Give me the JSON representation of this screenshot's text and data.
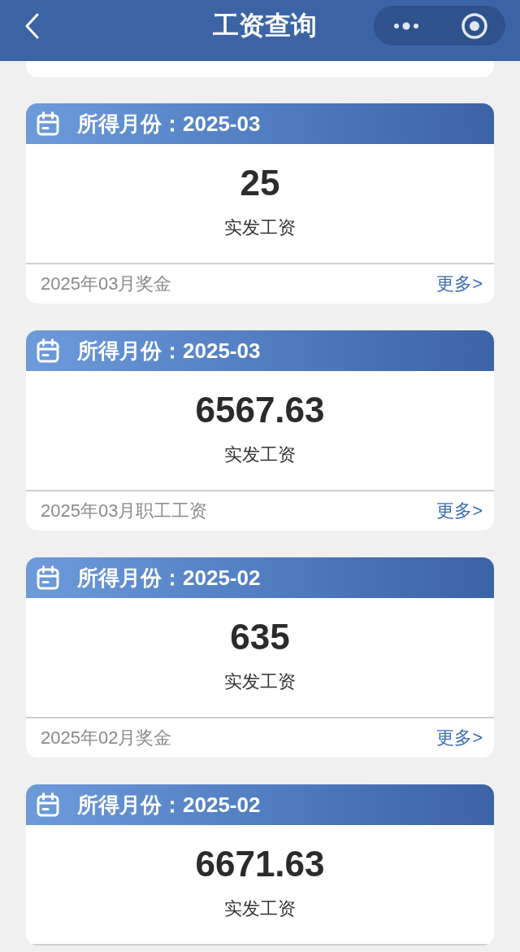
{
  "nav": {
    "title": "工资查询"
  },
  "records": [
    {
      "month_title": "所得月份：2025-03",
      "amount": "25",
      "amount_label": "实发工资",
      "footer_title": "2025年03月奖金",
      "more_link": "更多>"
    },
    {
      "month_title": "所得月份：2025-03",
      "amount": "6567.63",
      "amount_label": "实发工资",
      "footer_title": "2025年03月职工工资",
      "more_link": "更多>"
    },
    {
      "month_title": "所得月份：2025-02",
      "amount": "635",
      "amount_label": "实发工资",
      "footer_title": "2025年02月奖金",
      "more_link": "更多>"
    },
    {
      "month_title": "所得月份：2025-02",
      "amount": "6671.63",
      "amount_label": "实发工资"
    }
  ]
}
